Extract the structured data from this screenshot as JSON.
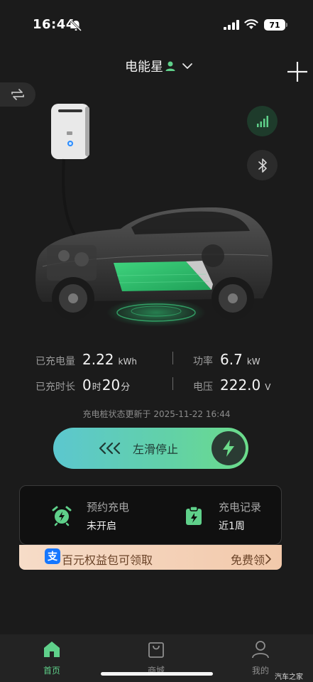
{
  "status_bar": {
    "time": "16:44",
    "battery": "71"
  },
  "header": {
    "device_name": "电能星"
  },
  "stats": {
    "charged_label": "已充电量",
    "charged_value": "2.22",
    "charged_unit": "kWh",
    "power_label": "功率",
    "power_value": "6.7",
    "power_unit": "kW",
    "duration_label": "已充时长",
    "duration_hours": "0",
    "duration_hours_unit": "时",
    "duration_minutes": "20",
    "duration_minutes_unit": "分",
    "voltage_label": "电压",
    "voltage_value": "222.0",
    "voltage_unit": "V"
  },
  "status_update": "充电桩状态更新于 2025-11-22 16:44",
  "slider": {
    "label": "左滑停止"
  },
  "card": {
    "schedule_title": "预约充电",
    "schedule_value": "未开启",
    "record_title": "充电记录",
    "record_value": "近1周"
  },
  "promo": {
    "badge": "支",
    "text": "百元权益包可领取",
    "cta": "免费领"
  },
  "tabs": [
    {
      "label": "首页",
      "active": true
    },
    {
      "label": "商城",
      "active": false
    },
    {
      "label": "我的",
      "active": false
    }
  ],
  "watermark": "汽车之家",
  "colors": {
    "accent": "#5fd08a",
    "background": "#1b1b1b",
    "promo_text": "#6a4328"
  }
}
